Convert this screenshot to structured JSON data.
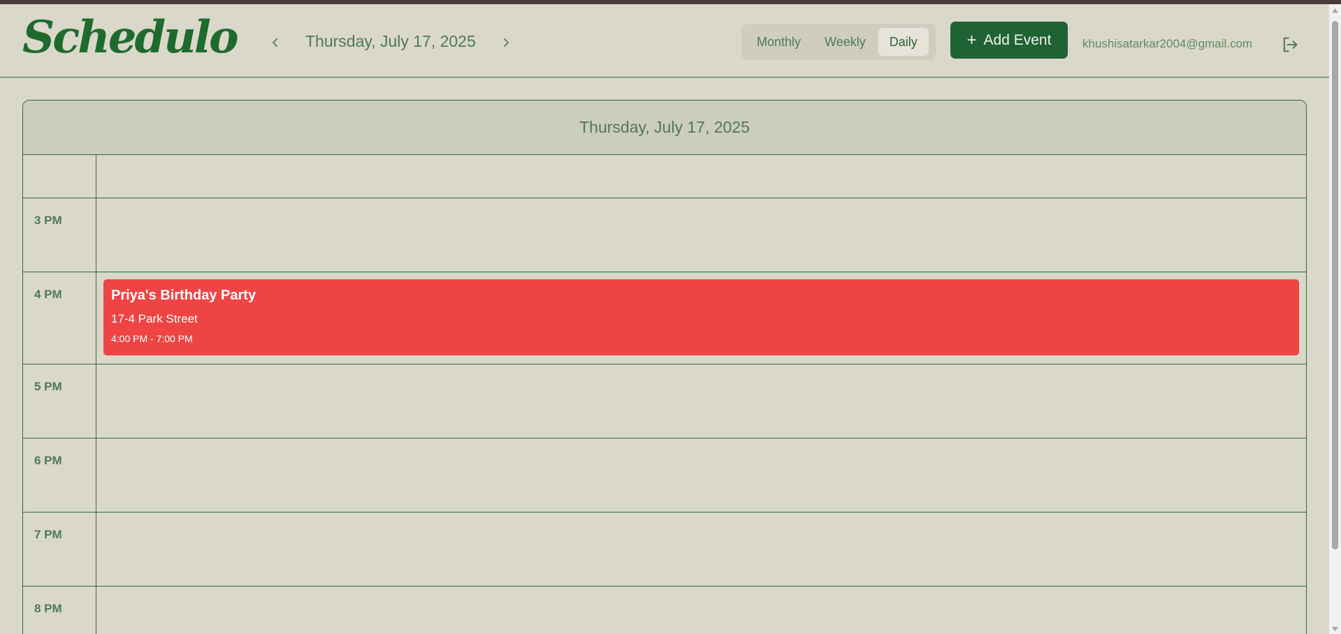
{
  "app": {
    "logo": "Schedulo"
  },
  "header": {
    "current_date": "Thursday, July 17, 2025",
    "views": [
      "Monthly",
      "Weekly",
      "Daily"
    ],
    "active_view": "Daily",
    "add_event_label": "Add Event",
    "user_email": "khushisatarkar2004@gmail.com"
  },
  "calendar": {
    "title": "Thursday, July 17, 2025",
    "hours": [
      "3 PM",
      "4 PM",
      "5 PM",
      "6 PM",
      "7 PM",
      "8 PM"
    ],
    "events": [
      {
        "title": "Priya's Birthday Party",
        "location": "17-4 Park Street",
        "time": "4:00 PM - 7:00 PM",
        "color": "#ef4444"
      }
    ]
  },
  "colors": {
    "background": "#dad8ca",
    "accent": "#1f6234",
    "event": "#ef4444"
  }
}
